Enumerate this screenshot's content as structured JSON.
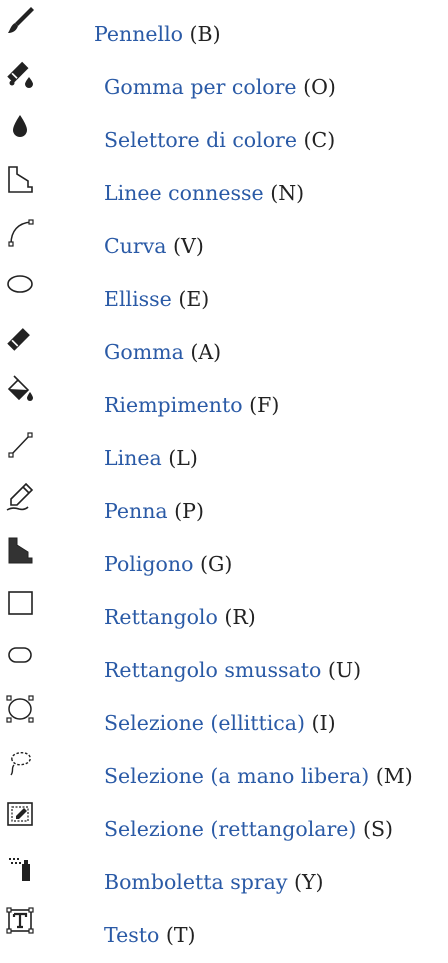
{
  "tools": [
    {
      "name": "Pennello",
      "key": "(B)",
      "icon": "brush-icon"
    },
    {
      "name": "Gomma per colore",
      "key": "(O)",
      "icon": "color-eraser-icon"
    },
    {
      "name": "Selettore di colore",
      "key": "(C)",
      "icon": "color-picker-icon"
    },
    {
      "name": "Linee connesse",
      "key": "(N)",
      "icon": "connected-lines-icon"
    },
    {
      "name": "Curva",
      "key": "(V)",
      "icon": "curve-icon"
    },
    {
      "name": "Ellisse",
      "key": "(E)",
      "icon": "ellipse-icon"
    },
    {
      "name": "Gomma",
      "key": "(A)",
      "icon": "eraser-icon"
    },
    {
      "name": "Riempimento",
      "key": "(F)",
      "icon": "fill-bucket-icon"
    },
    {
      "name": "Linea",
      "key": "(L)",
      "icon": "line-icon"
    },
    {
      "name": "Penna",
      "key": "(P)",
      "icon": "pen-icon"
    },
    {
      "name": "Poligono",
      "key": "(G)",
      "icon": "polygon-icon"
    },
    {
      "name": "Rettangolo",
      "key": "(R)",
      "icon": "rectangle-icon"
    },
    {
      "name": "Rettangolo smussato",
      "key": "(U)",
      "icon": "rounded-rectangle-icon"
    },
    {
      "name": "Selezione (ellittica)",
      "key": "(I)",
      "icon": "elliptical-selection-icon"
    },
    {
      "name": "Selezione (a mano libera)",
      "key": "(M)",
      "icon": "freehand-selection-icon"
    },
    {
      "name": "Selezione (rettangolare)",
      "key": "(S)",
      "icon": "rectangular-selection-icon"
    },
    {
      "name": "Bomboletta spray",
      "key": "(Y)",
      "icon": "spray-can-icon"
    },
    {
      "name": "Testo",
      "key": "(T)",
      "icon": "text-icon"
    }
  ]
}
